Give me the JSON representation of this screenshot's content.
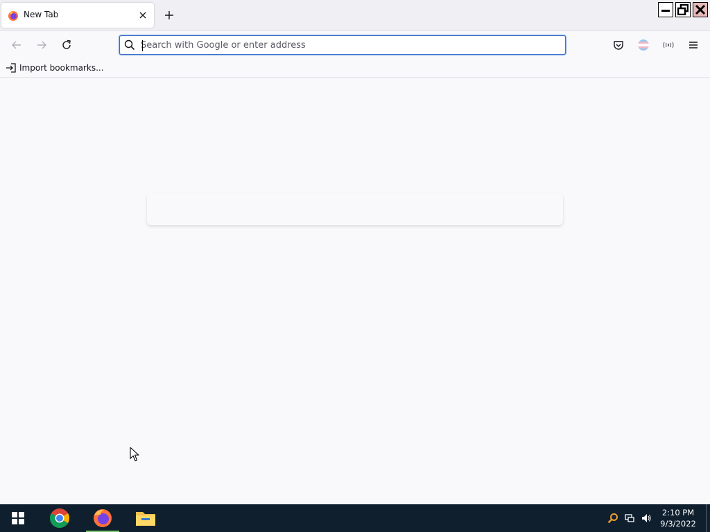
{
  "browser": {
    "tab": {
      "title": "New Tab"
    },
    "urlbar": {
      "placeholder": "Search with Google or enter address",
      "value": ""
    },
    "bookmarks": {
      "import_label": "Import bookmarks..."
    }
  },
  "taskbar": {
    "apps": [
      {
        "name": "Start",
        "icon": "windows-icon"
      },
      {
        "name": "Google Chrome",
        "icon": "chrome-icon"
      },
      {
        "name": "Firefox",
        "icon": "firefox-icon",
        "active": true
      },
      {
        "name": "File Explorer",
        "icon": "folder-icon"
      }
    ],
    "clock": {
      "time": "2:10 PM",
      "date": "9/3/2022"
    }
  },
  "colors": {
    "chrome_bg": "#f0f0f4",
    "toolbar_bg": "#f9f9fb",
    "focus_ring": "#3f73c4",
    "taskbar_bg": "#0f1f2e",
    "active_app_indicator": "#7bc96f"
  }
}
